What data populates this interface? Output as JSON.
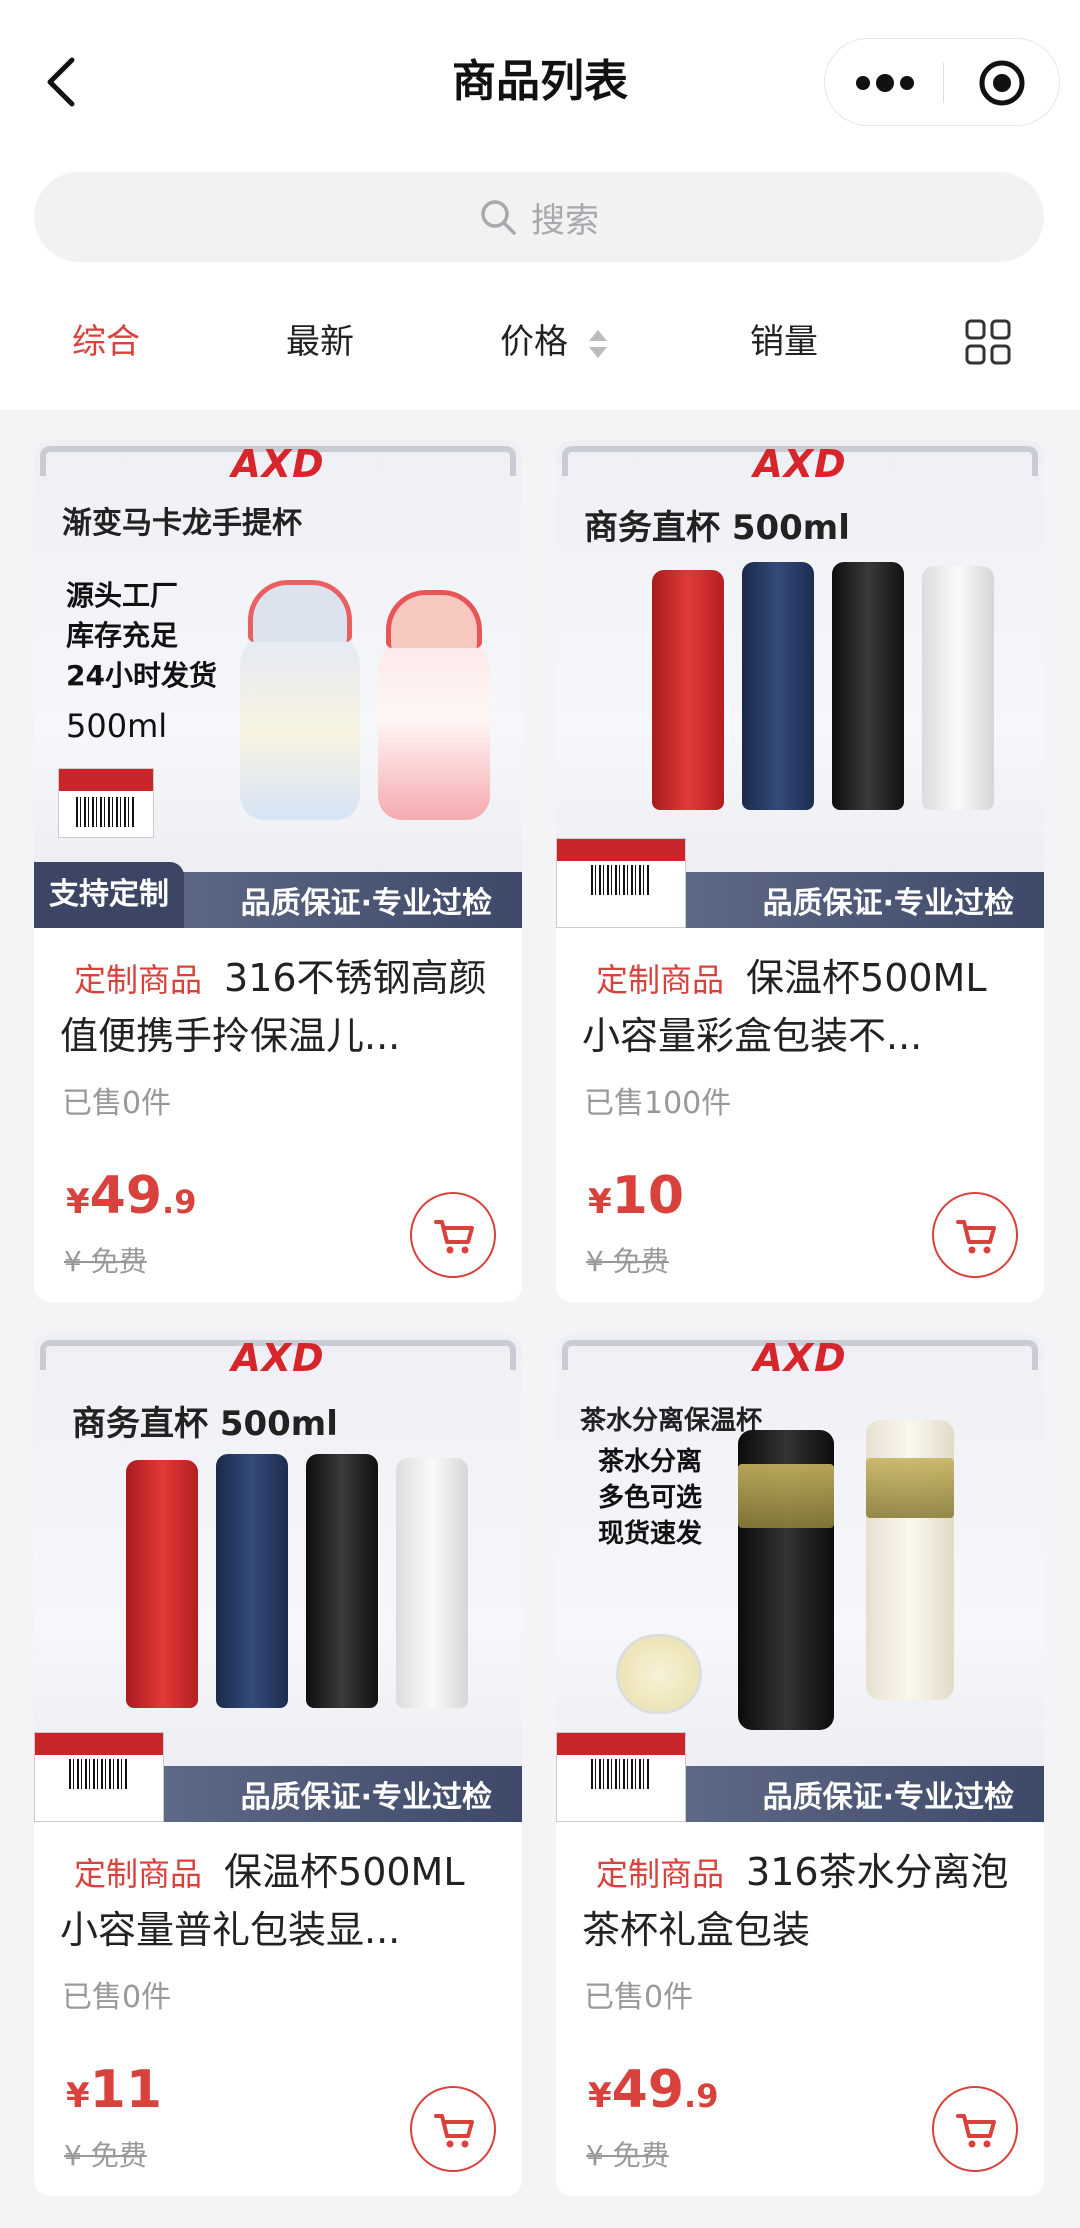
{
  "nav": {
    "title": "商品列表"
  },
  "search": {
    "placeholder": "搜索"
  },
  "filters": {
    "items": [
      "综合",
      "最新",
      "价格",
      "销量"
    ],
    "active": "综合"
  },
  "accent_color": "#d8413c",
  "icons": [
    "chevron-left-icon",
    "more-dots-icon",
    "record-icon",
    "search-icon",
    "sort-arrows-icon",
    "grid-view-icon",
    "cart-icon"
  ],
  "products": [
    {
      "image": {
        "brand": "AXD",
        "title": "渐变马卡龙手提杯",
        "features": [
          "源头工厂",
          "库存充足",
          "24小时发货"
        ],
        "volume": "500ml",
        "custom": "支持定制",
        "quality": "品质保证·专业过检"
      },
      "badge": "定制商品",
      "name": "316不锈钢高颜值便携手拎保温儿...",
      "sold": "已售0件",
      "price_symbol": "¥",
      "price_int": "49",
      "price_dec": ".9",
      "original_price": "¥ 免费"
    },
    {
      "image": {
        "brand": "AXD",
        "title": "商务直杯  500ml",
        "quality": "品质保证·专业过检"
      },
      "badge": "定制商品",
      "name": "保温杯500ML小容量彩盒包装不...",
      "sold": "已售100件",
      "price_symbol": "¥",
      "price_int": "10",
      "price_dec": "",
      "original_price": "¥ 免费"
    },
    {
      "image": {
        "brand": "AXD",
        "title": "商务直杯  500ml",
        "quality": "品质保证·专业过检"
      },
      "badge": "定制商品",
      "name": "保温杯500ML小容量普礼包装显...",
      "sold": "已售0件",
      "price_symbol": "¥",
      "price_int": "11",
      "price_dec": "",
      "original_price": "¥ 免费"
    },
    {
      "image": {
        "brand": "AXD",
        "title": "茶水分离保温杯",
        "features": [
          "茶水分离",
          "多色可选",
          "现货速发"
        ],
        "quality": "品质保证·专业过检"
      },
      "badge": "定制商品",
      "name": "316茶水分离泡茶杯礼盒包装",
      "sold": "已售0件",
      "price_symbol": "¥",
      "price_int": "49",
      "price_dec": ".9",
      "original_price": "¥ 免费"
    }
  ]
}
